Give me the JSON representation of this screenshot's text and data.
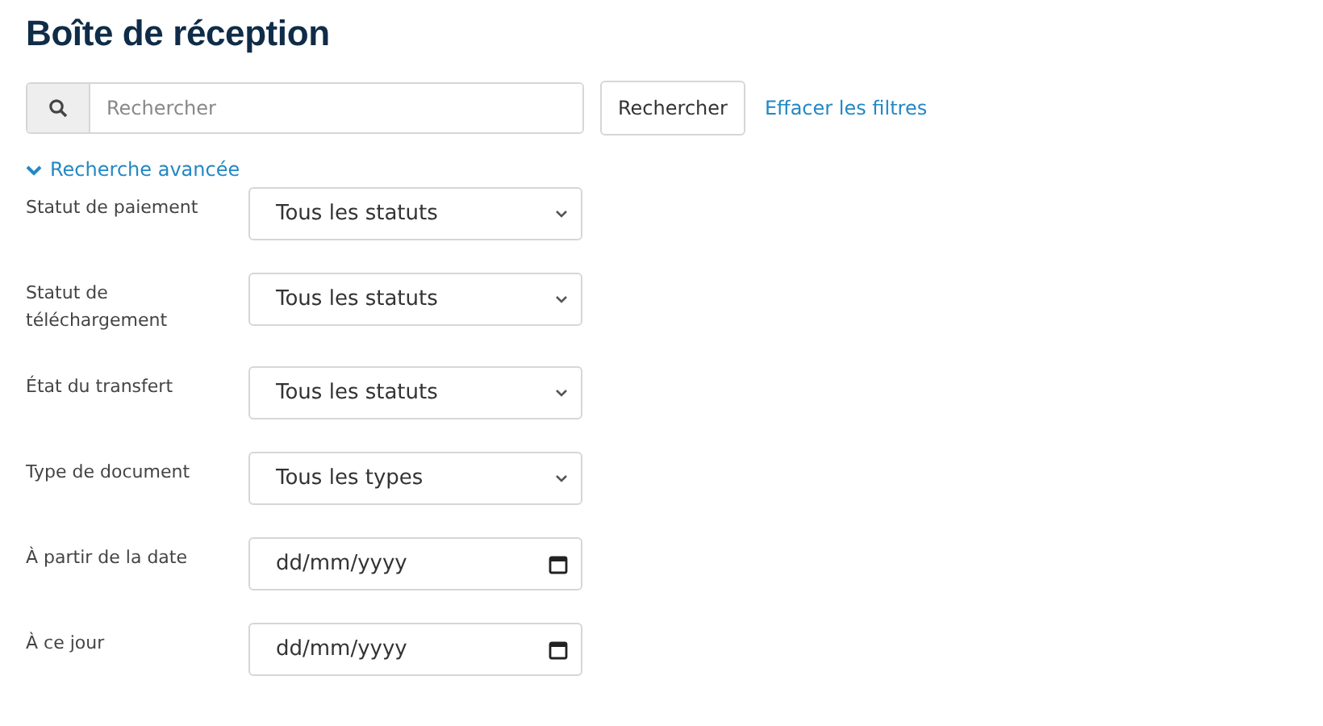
{
  "title": "Boîte de réception",
  "search": {
    "placeholder": "Rechercher",
    "button": "Rechercher",
    "clear_link": "Effacer les filtres"
  },
  "advanced": {
    "label": "Recherche avancée",
    "expanded": true
  },
  "filters": [
    {
      "kind": "select",
      "label": "Statut de paiement",
      "value": "Tous les statuts"
    },
    {
      "kind": "select",
      "label": "Statut de téléchargement",
      "value": "Tous les statuts"
    },
    {
      "kind": "select",
      "label": "État du transfert",
      "value": "Tous les statuts"
    },
    {
      "kind": "select",
      "label": "Type de document",
      "value": "Tous les types"
    },
    {
      "kind": "date",
      "label": "À partir de la date",
      "placeholder": "dd/mm/yyyy"
    },
    {
      "kind": "date",
      "label": "À ce jour",
      "placeholder": "dd/mm/yyyy"
    }
  ]
}
